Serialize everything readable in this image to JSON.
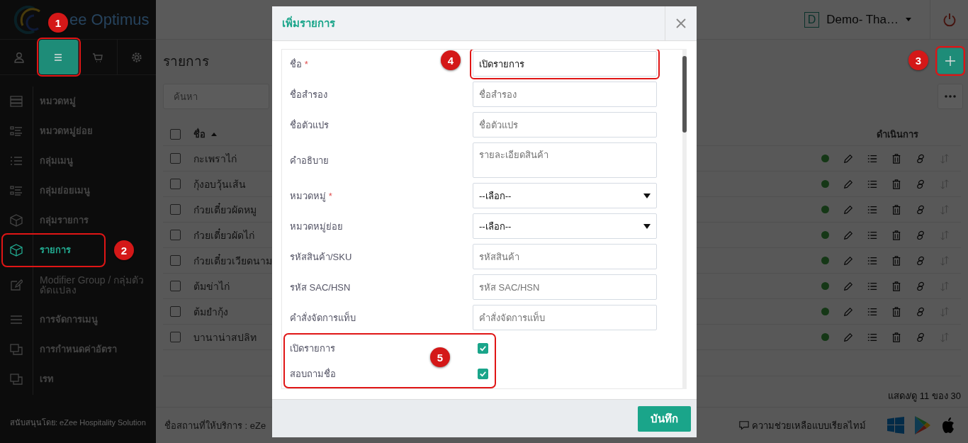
{
  "header": {
    "logo_text": "ee Optimus",
    "user_initial": "D",
    "user_name": "Demo- Tha…"
  },
  "sidebar": {
    "tabs": [
      {
        "selected": false
      },
      {
        "selected": true
      },
      {
        "selected": false
      },
      {
        "selected": false
      }
    ],
    "items": [
      {
        "label": "หมวดหมู่",
        "selected": false
      },
      {
        "label": "หมวดหมู่ย่อย",
        "selected": false
      },
      {
        "label": "กลุ่มเมนู",
        "selected": false
      },
      {
        "label": "กลุ่มย่อยเมนู",
        "selected": false
      },
      {
        "label": "กลุ่มรายการ",
        "selected": false
      },
      {
        "label": "รายการ",
        "selected": true
      },
      {
        "label": "Modifier Group / กลุ่มตัวดัดแปลง",
        "selected": false
      },
      {
        "label": "การจัดการเมนู",
        "selected": false
      },
      {
        "label": "การกำหนดค่าอัตรา",
        "selected": false
      },
      {
        "label": "เรท",
        "selected": false
      }
    ],
    "footer": "สนับสนุนโดย: eZee Hospitality Solution"
  },
  "page": {
    "title": "รายการ",
    "search_placeholder": "ค้นหา",
    "select_all_checked": false,
    "columns": [
      "ชื่อ",
      "ดำเนินการ"
    ],
    "rows": [
      {
        "name": "กะเพราไก่",
        "checked": false,
        "active": true
      },
      {
        "name": "กุ้งอบวุ้นเส้น",
        "checked": false,
        "active": true
      },
      {
        "name": "ก๋วยเตี๋ยวผัดหมู",
        "checked": false,
        "active": true
      },
      {
        "name": "ก๋วยเตี๋ยวผัดไก่",
        "checked": false,
        "active": true
      },
      {
        "name": "ก๋วยเตี๋ยวเวียดนาม",
        "checked": false,
        "active": true
      },
      {
        "name": "ต้มข่าไก่",
        "checked": false,
        "active": true
      },
      {
        "name": "ต้มยำกุ้ง",
        "checked": false,
        "active": true
      },
      {
        "name": "บานาน่าสปลิท",
        "checked": false,
        "active": true
      }
    ],
    "count": "แสดง/ดู 11 ของ 30"
  },
  "footer": {
    "location": "ชื่อสถานที่ให้บริการ : eZe",
    "help": "ความช่วยเหลือแบบเรียลไทม์"
  },
  "dialog": {
    "title": "เพิ่มรายการ",
    "fields": [
      {
        "kind": "text",
        "label": "ชื่อ",
        "required_mark": "*",
        "value": "เปิดรายการ"
      },
      {
        "kind": "text",
        "label": "ชื่อสำรอง",
        "placeholder": "ชื่อสำรอง"
      },
      {
        "kind": "text",
        "label": "ชื่อตัวแปร",
        "placeholder": "ชื่อตัวแปร"
      },
      {
        "kind": "textarea",
        "label": "คำอธิบาย",
        "placeholder": "รายละเอียดสินค้า"
      },
      {
        "kind": "select",
        "label": "หมวดหมู่",
        "required_mark": "*",
        "value": "--เลือก--"
      },
      {
        "kind": "select",
        "label": "หมวดหมู่ย่อย",
        "value": "--เลือก--"
      },
      {
        "kind": "text",
        "label": "รหัสสินค้า/SKU",
        "placeholder": "รหัสสินค้า"
      },
      {
        "kind": "text",
        "label": "รหัส SAC/HSN",
        "placeholder": "รหัส SAC/HSN"
      },
      {
        "kind": "text",
        "label": "คำสั่งจัดการแท็บ",
        "placeholder": "คำสั่งจัดการแท็บ"
      }
    ],
    "toggles": [
      {
        "label": "เปิดรายการ",
        "checked": true
      },
      {
        "label": "สอบถามชื่อ",
        "checked": true
      }
    ],
    "save": "บันทึก"
  },
  "annotations": [
    {
      "number": "1"
    },
    {
      "number": "2"
    },
    {
      "number": "3"
    },
    {
      "number": "4"
    },
    {
      "number": "5"
    }
  ]
}
